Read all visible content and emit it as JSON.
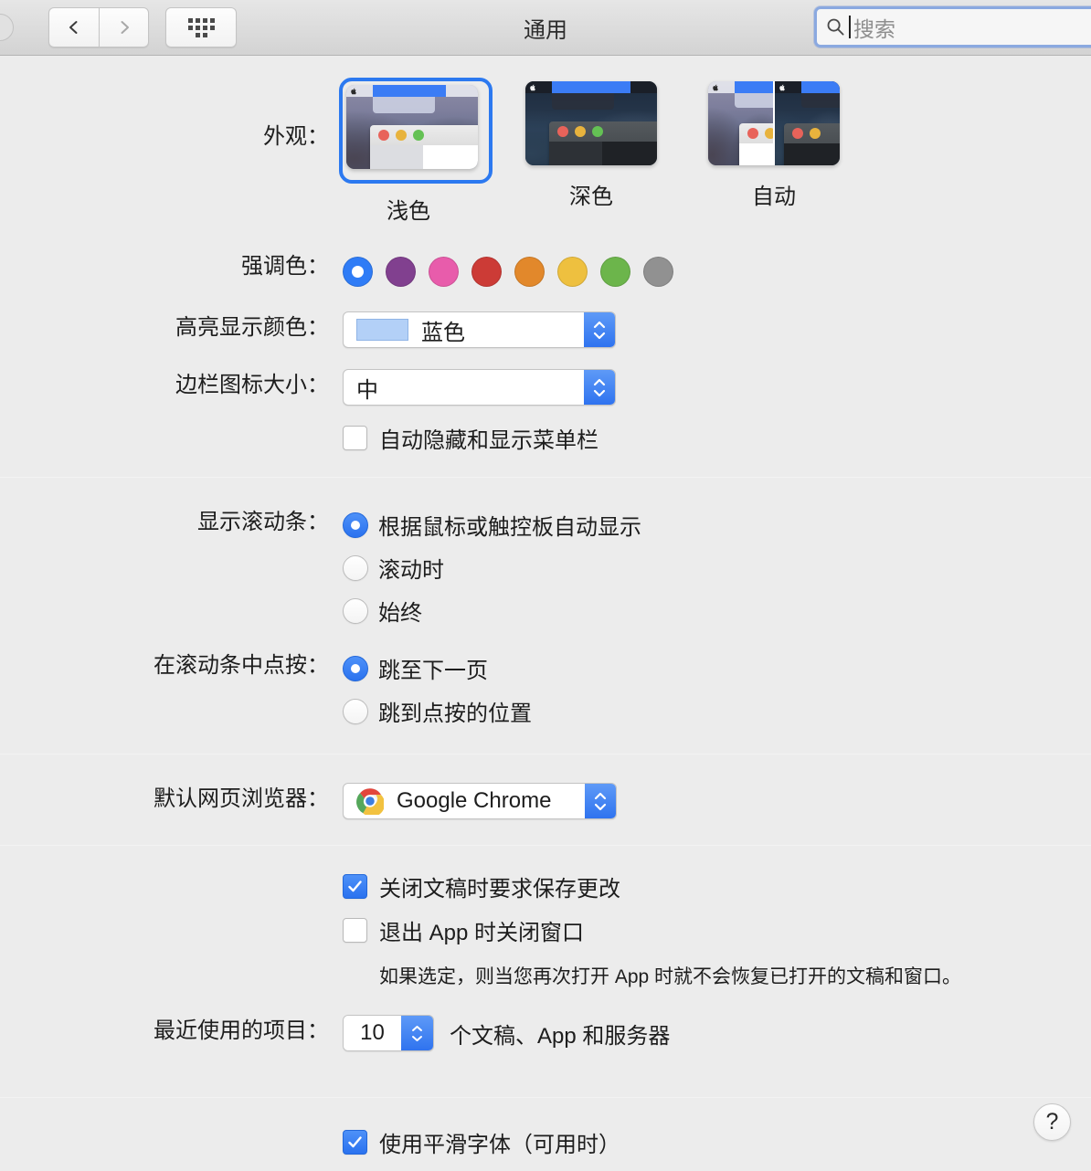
{
  "window": {
    "title": "通用"
  },
  "toolbar": {
    "back_icon": "chevron-left-icon",
    "forward_icon": "chevron-right-icon",
    "grid_icon": "show-all-grid-icon",
    "close_button": "close-window-button"
  },
  "search": {
    "placeholder": "搜索",
    "value": "",
    "icon": "search-icon",
    "focused": true
  },
  "appearance": {
    "label": "外观：",
    "selected": "浅色",
    "options": [
      {
        "id": "light",
        "label": "浅色"
      },
      {
        "id": "dark",
        "label": "深色"
      },
      {
        "id": "auto",
        "label": "自动"
      }
    ]
  },
  "accent": {
    "label": "强调色：",
    "selected_index": 0,
    "colors": [
      {
        "name": "blue",
        "hex": "#2f7cf6"
      },
      {
        "name": "purple",
        "hex": "#81408f"
      },
      {
        "name": "pink",
        "hex": "#e85cab"
      },
      {
        "name": "red",
        "hex": "#cc3b36"
      },
      {
        "name": "orange",
        "hex": "#e2882b"
      },
      {
        "name": "yellow",
        "hex": "#eec03f"
      },
      {
        "name": "green",
        "hex": "#6cb54b"
      },
      {
        "name": "graphite",
        "hex": "#919191"
      }
    ]
  },
  "highlight": {
    "label": "高亮显示颜色：",
    "value": "蓝色",
    "swatch_hex": "#b3d0f7"
  },
  "sidebar_icon_size": {
    "label": "边栏图标大小：",
    "value": "中"
  },
  "auto_hide_menubar": {
    "label": "自动隐藏和显示菜单栏",
    "checked": false
  },
  "show_scrollbars": {
    "label": "显示滚动条：",
    "selected_index": 0,
    "options": [
      "根据鼠标或触控板自动显示",
      "滚动时",
      "始终"
    ]
  },
  "click_scrollbar": {
    "label": "在滚动条中点按：",
    "selected_index": 0,
    "options": [
      "跳至下一页",
      "跳到点按的位置"
    ]
  },
  "default_browser": {
    "label": "默认网页浏览器：",
    "value": "Google Chrome",
    "icon": "chrome-icon"
  },
  "documents": {
    "ask_save_label": "关闭文稿时要求保存更改",
    "ask_save_checked": true,
    "close_windows_label": "退出 App 时关闭窗口",
    "close_windows_checked": false,
    "hint": "如果选定，则当您再次打开 App 时就不会恢复已打开的文稿和窗口。"
  },
  "recent_items": {
    "label": "最近使用的项目：",
    "value": "10",
    "suffix": "个文稿、App 和服务器"
  },
  "font_smoothing": {
    "label": "使用平滑字体（可用时）",
    "checked": true
  },
  "help": {
    "glyph": "?",
    "name": "help-button"
  }
}
